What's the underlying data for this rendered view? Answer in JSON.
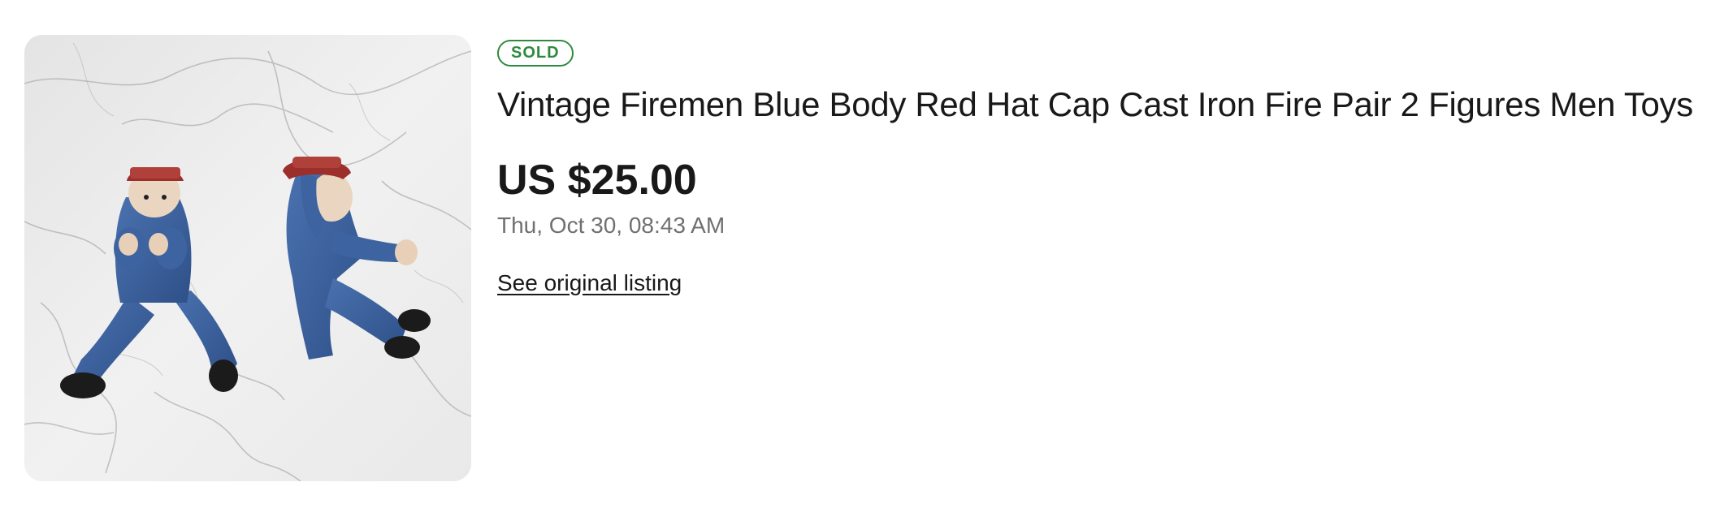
{
  "listing": {
    "status_badge": "SOLD",
    "title": "Vintage Firemen Blue Body Red Hat Cap Cast Iron Fire Pair 2 Figures Men Toys",
    "price": "US $25.00",
    "date": "Thu, Oct 30, 08:43 AM",
    "link_label": "See original listing",
    "image_alt": "product photo"
  },
  "colors": {
    "badge_green": "#2f8a3f",
    "title_text": "#191919",
    "date_gray": "#707070",
    "figure_blue": "#3d64a0",
    "hat_red": "#9c2f2b"
  }
}
